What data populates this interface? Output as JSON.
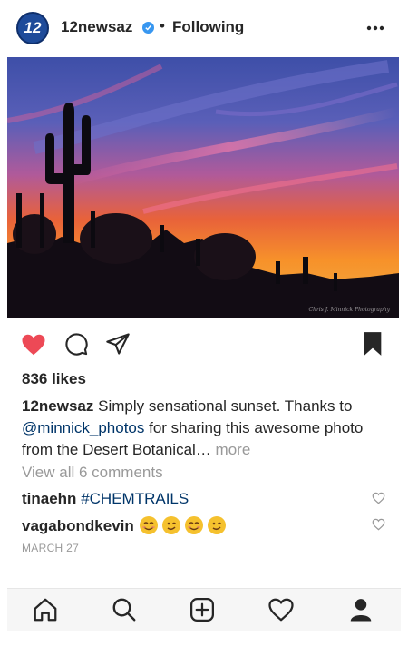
{
  "header": {
    "avatar_text": "12",
    "username": "12newsaz",
    "separator": "•",
    "follow_status": "Following"
  },
  "photo": {
    "watermark": "Chris J. Minnick Photography"
  },
  "post": {
    "likes": "836 likes",
    "caption_user": "12newsaz",
    "caption_text_1": " Simply sensational sunset. Thanks to ",
    "caption_mention": "@minnick_photos",
    "caption_text_2": " for sharing this awesome photo from the Desert Botanical…",
    "caption_more": " more",
    "view_comments": "View all 6 comments",
    "comments": [
      {
        "user": "tinaehn",
        "text": "#CHEMTRAILS"
      },
      {
        "user": "vagabondkevin",
        "text": ""
      }
    ],
    "date": "MARCH 27"
  },
  "colors": {
    "like_red": "#ed4956",
    "verified_blue": "#3897f0",
    "link_blue": "#003569",
    "muted_gray": "#999999"
  },
  "icons": {
    "actions": [
      "heart-filled-icon",
      "comment-icon",
      "share-icon",
      "bookmark-icon"
    ],
    "tabs": [
      "home-icon",
      "search-icon",
      "new-post-icon",
      "activity-icon",
      "profile-icon"
    ]
  }
}
